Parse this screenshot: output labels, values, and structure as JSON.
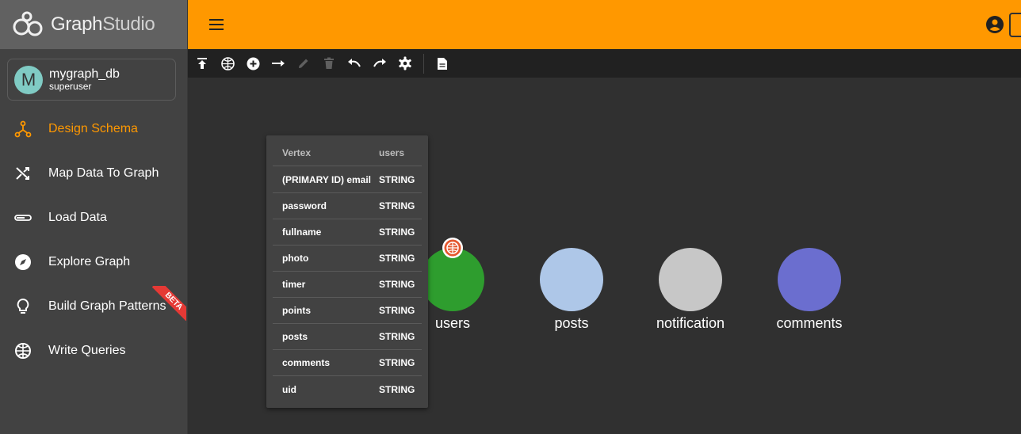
{
  "brand": {
    "name_part1": "Graph",
    "name_part2": "Studio"
  },
  "graph": {
    "avatar_letter": "M",
    "name": "mygraph_db",
    "role": "superuser"
  },
  "nav": [
    {
      "label": "Design Schema",
      "icon": "schema-icon",
      "active": true
    },
    {
      "label": "Map Data To Graph",
      "icon": "shuffle-icon"
    },
    {
      "label": "Load Data",
      "icon": "load-icon"
    },
    {
      "label": "Explore Graph",
      "icon": "compass-icon"
    },
    {
      "label": "Build Graph Patterns",
      "icon": "lightbulb-icon",
      "badge": "BETA"
    },
    {
      "label": "Write Queries",
      "icon": "globe-grid-icon"
    }
  ],
  "colors": {
    "accent": "#ff9800",
    "beta": "#e53935"
  },
  "vertices": [
    {
      "name": "users",
      "color": "#2e9d2e"
    },
    {
      "name": "posts",
      "color": "#aec7e8"
    },
    {
      "name": "notification",
      "color": "#c7c7c7"
    },
    {
      "name": "comments",
      "color": "#6b6ecf"
    }
  ],
  "tooltip": {
    "header": [
      "Vertex",
      "users"
    ],
    "rows": [
      [
        "(PRIMARY ID) email",
        "STRING"
      ],
      [
        "password",
        "STRING"
      ],
      [
        "fullname",
        "STRING"
      ],
      [
        "photo",
        "STRING"
      ],
      [
        "timer",
        "STRING"
      ],
      [
        "points",
        "STRING"
      ],
      [
        "posts",
        "STRING"
      ],
      [
        "comments",
        "STRING"
      ],
      [
        "uid",
        "STRING"
      ]
    ]
  }
}
